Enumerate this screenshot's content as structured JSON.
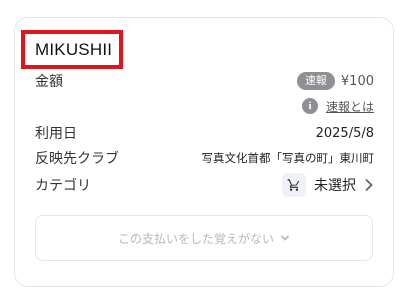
{
  "merchant": {
    "name": "MIKUSHII"
  },
  "amount": {
    "label": "金額",
    "badge": "速報",
    "value": "¥100"
  },
  "info": {
    "icon_name": "info-icon",
    "link_text": "速報とは"
  },
  "date": {
    "label": "利用日",
    "value": "2025/5/8"
  },
  "club": {
    "label": "反映先クラブ",
    "value": "写真文化首都「写真の町」東川町"
  },
  "category": {
    "label": "カテゴリ",
    "icon_name": "cart-icon",
    "value": "未選択"
  },
  "not_me_button": {
    "label": "この支払いをした覚えがない"
  },
  "colors": {
    "highlight_border": "#e0141e",
    "badge": "#8e8e93",
    "muted_text": "#b8b8b8"
  }
}
